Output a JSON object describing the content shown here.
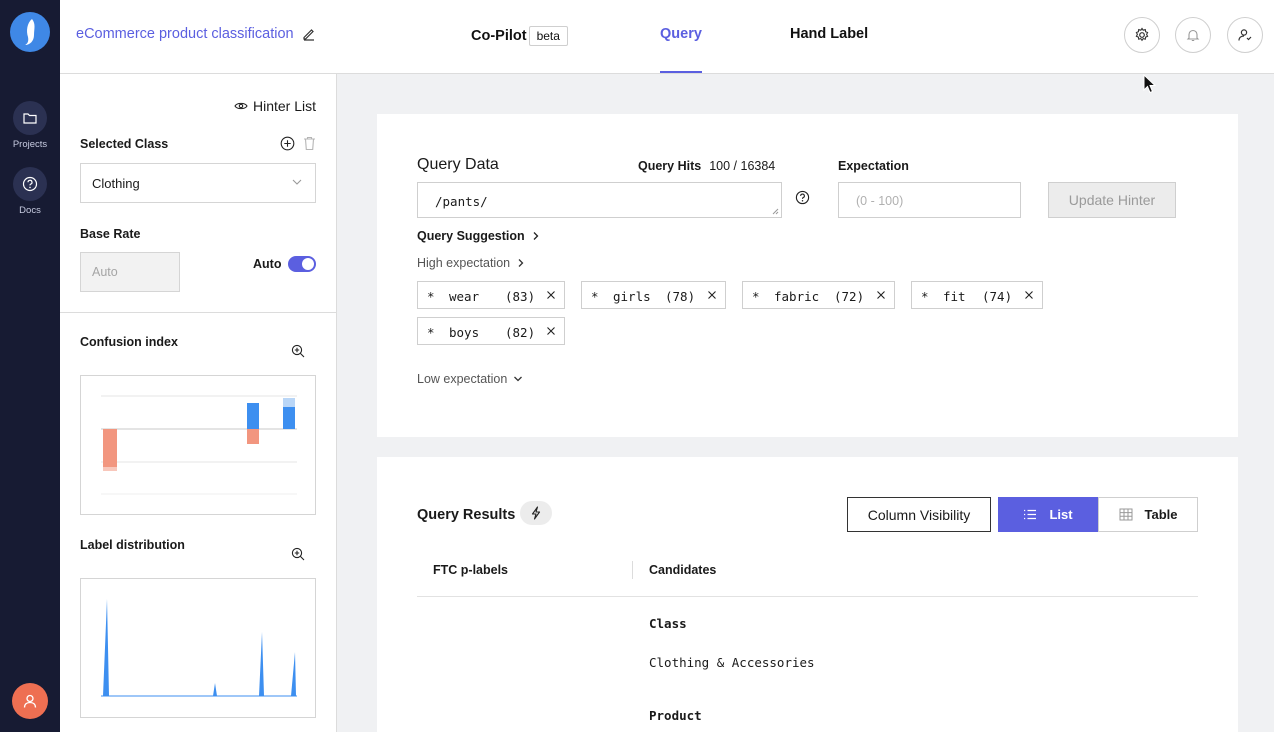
{
  "rail": {
    "items": [
      {
        "label": "Projects",
        "icon": "folder-icon"
      },
      {
        "label": "Docs",
        "icon": "help-circle-icon"
      }
    ]
  },
  "topbar": {
    "project_title": "eCommerce product classification",
    "tabs": [
      {
        "label": "Co-Pilot",
        "badge": "beta"
      },
      {
        "label": "Query",
        "active": true
      },
      {
        "label": "Hand Label"
      }
    ]
  },
  "side": {
    "hinter_list": "Hinter List",
    "selected_class_label": "Selected Class",
    "selected_class_value": "Clothing",
    "base_rate_label": "Base Rate",
    "base_rate_placeholder": "Auto",
    "auto_label": "Auto",
    "confusion_title": "Confusion index",
    "label_dist_title": "Label distribution"
  },
  "query": {
    "title": "Query Data",
    "hits_label": "Query Hits",
    "hits_value": "100 / 16384",
    "input_value": "/pants/",
    "expectation_label": "Expectation",
    "expectation_placeholder": "(0 - 100)",
    "update_button": "Update Hinter",
    "suggestion_label": "Query Suggestion",
    "high_expectation": "High expectation",
    "low_expectation": "Low expectation",
    "chips": [
      {
        "star": "*",
        "word": "wear",
        "score": "(83)"
      },
      {
        "star": "*",
        "word": "girls",
        "score": "(78)"
      },
      {
        "star": "*",
        "word": "fabric",
        "score": "(72)"
      },
      {
        "star": "*",
        "word": "fit",
        "score": "(74)"
      },
      {
        "star": "*",
        "word": "boys",
        "score": "(82)"
      }
    ]
  },
  "results": {
    "title": "Query Results",
    "column_visibility": "Column Visibility",
    "list_button": "List",
    "table_button": "Table",
    "columns": [
      "FTC p-labels",
      "Candidates"
    ],
    "fields": [
      {
        "key": "Class",
        "value": "Clothing & Accessories"
      },
      {
        "key": "Product",
        "value": ""
      }
    ]
  },
  "colors": {
    "accent": "#5b5fe0",
    "rail": "#171b33",
    "chart_blue": "#3d8ff0",
    "chart_red": "#f2967f"
  }
}
